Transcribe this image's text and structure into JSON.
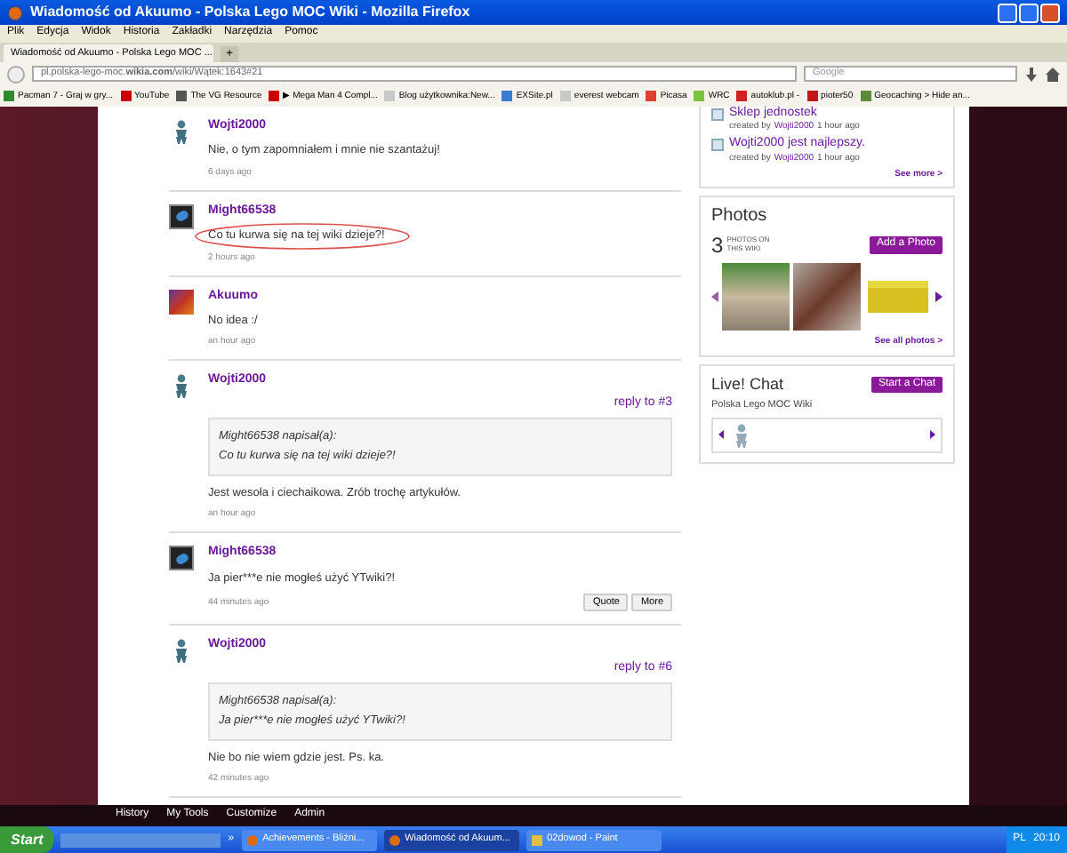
{
  "window": {
    "title": "Wiadomość od Akuumo - Polska Lego MOC Wiki - Mozilla Firefox"
  },
  "menu": [
    "Plik",
    "Edycja",
    "Widok",
    "Historia",
    "Zakładki",
    "Narzędzia",
    "Pomoc"
  ],
  "tabs": [
    {
      "label": "Wiadomość od Akuumo - Polska Lego MOC ...",
      "selected": true
    }
  ],
  "new_tab": "+",
  "address_bar": {
    "url": "pl.polska-lego-moc.**wikia.com**/wiki/Wątek:1643#21"
  },
  "search": {
    "placeholder": "Google"
  },
  "bookmarks": [
    {
      "label": "Pacman 7 - Graj w gry...",
      "color": "#2e8b2e"
    },
    {
      "label": "YouTube",
      "color": "#cc0000"
    },
    {
      "label": "The VG Resource",
      "color": "#555555"
    },
    {
      "label": "▶ Mega Man 4 Compl...",
      "color": "#cc0000"
    },
    {
      "label": "Blog użytkownika:New...",
      "color": "#c8c8c8"
    },
    {
      "label": "EXSite.pl",
      "color": "#3a7bd5"
    },
    {
      "label": "everest webcam",
      "color": "#c8c8c8"
    },
    {
      "label": "Picasa",
      "color": "#e04030"
    },
    {
      "label": "WRC",
      "color": "#7cc242"
    },
    {
      "label": "autoklub.pl -",
      "color": "#d02020"
    },
    {
      "label": "pioter50",
      "color": "#c01818"
    },
    {
      "label": "Geocaching > Hide an...",
      "color": "#5a8a3a"
    }
  ],
  "comments": [
    {
      "author": "Wojti2000",
      "kind": "figure",
      "text": "Nie, o tym zapomniałem i mnie nie szantażuj!",
      "time": "6 days ago",
      "circled": false
    },
    {
      "author": "Might66538",
      "kind": "dark",
      "text": "Co tu kurwa się na tej wiki dzieje?!",
      "time": "2 hours ago",
      "circled": true
    },
    {
      "author": "Akuumo",
      "kind": "colorful",
      "text": "No idea :/",
      "time": "an hour ago",
      "circled": false
    },
    {
      "author": "Wojti2000",
      "kind": "figure",
      "reply_to": "reply to #3",
      "quote": {
        "header": "Might66538 napisał(a):",
        "text": "Co tu kurwa się na tej wiki dzieje?!"
      },
      "text": "Jest wesoła i ciechaikowa. Zrób trochę artykułów.",
      "time": "an hour ago",
      "circled": false
    },
    {
      "author": "Might66538",
      "kind": "dark",
      "text": "Ja pier***e nie mogłeś użyć YTwiki?!",
      "time": "44 minutes ago",
      "circled": false,
      "buttons": [
        "Quote",
        "More"
      ]
    },
    {
      "author": "Wojti2000",
      "kind": "figure",
      "reply_to": "reply to #6",
      "quote": {
        "header": "Might66538 napisał(a):",
        "text": "Ja pier***e nie mogłeś użyć YTwiki?!"
      },
      "text": "Nie bo nie wiem gdzie jest. Ps. ka.",
      "time": "42 minutes ago",
      "circled": false
    }
  ],
  "activity": {
    "items": [
      {
        "title": "Sklep jednostek",
        "created_by": "created by",
        "user": "Wojti2000",
        "time": "1 hour ago"
      },
      {
        "title": "Wojti2000 jest najlepszy.",
        "created_by": "created by",
        "user": "Wojti2000",
        "time": "1 hour ago"
      }
    ],
    "see_more": "See more >"
  },
  "photos": {
    "title": "Photos",
    "count": "3",
    "count_label": "PHOTOS ON THIS WIKI",
    "add_button": "Add a Photo",
    "items": [
      {
        "kind": "snail"
      },
      {
        "kind": "slug"
      },
      {
        "kind": "brick"
      }
    ],
    "see_all": "See all photos >"
  },
  "chat": {
    "title": "Live! Chat",
    "button": "Start a Chat",
    "wiki": "Polska Lego MOC Wiki"
  },
  "wikia_toolbar": [
    "History",
    "My Tools",
    "Customize",
    "Admin"
  ],
  "taskbar": {
    "start": "Start",
    "more": "»",
    "tasks": [
      {
        "label": "Achievements - Bliźni...",
        "selected": false,
        "kind": "firefox"
      },
      {
        "label": "Wiadomość od Akuum...",
        "selected": true,
        "kind": "firefox"
      },
      {
        "label": "02dowod - Paint",
        "selected": false,
        "kind": "paint"
      }
    ],
    "language": "PL",
    "clock": "20:10"
  }
}
